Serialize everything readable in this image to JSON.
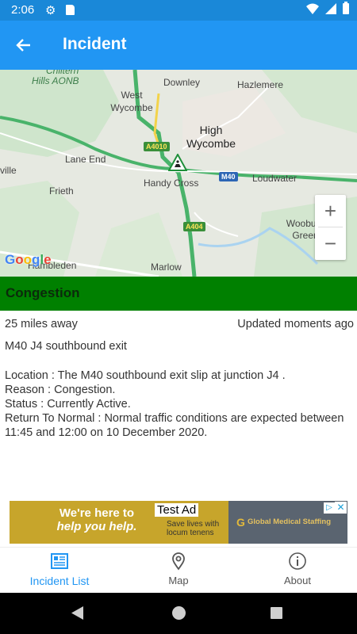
{
  "status_bar": {
    "time": "2:06",
    "icons": [
      "gear-icon",
      "sd-card-icon",
      "wifi-icon",
      "signal-icon",
      "battery-icon"
    ]
  },
  "app_bar": {
    "title": "Incident",
    "back_icon": "arrow-back-icon",
    "color": "#2196f3"
  },
  "map": {
    "labels": {
      "chiltern": "Chiltern",
      "hills_aonb": "Hills AONB",
      "downley": "Downley",
      "hazlemere": "Hazlemere",
      "west_wycombe": "West Wycombe",
      "high_wycombe": "High Wycombe",
      "lane_end": "Lane End",
      "ville": "ville",
      "frieth": "Frieth",
      "handy_cross": "Handy Cross",
      "loudwater": "Loudwater",
      "wooburn_green": "Wooburn Green",
      "hambleden": "Hambleden",
      "marlow": "Marlow"
    },
    "road_shields": {
      "a4010": "A4010",
      "m40": "M40",
      "a404": "A404"
    },
    "zoom_in": "+",
    "zoom_out": "−",
    "attribution": "Google"
  },
  "incident": {
    "status": "Congestion",
    "status_color": "#008000",
    "distance": "25 miles away",
    "updated": "Updated moments ago",
    "title": "M40 J4 southbound exit",
    "location": "Location : The M40 southbound exit slip at junction J4 .",
    "reason": "Reason : Congestion.",
    "status_line": "Status : Currently Active.",
    "return_to_normal": "Return To Normal : Normal traffic conditions are expected between 11:45 and 12:00 on 10 December 2020."
  },
  "ad": {
    "headline_1": "We're here to",
    "headline_2": "help you help.",
    "test_label": "Test Ad",
    "sub_1": "Save lives with",
    "sub_2": "locum tenens",
    "brand": "Global Medical Staffing",
    "choices_icon": "ad-choices-icon",
    "close": "✕"
  },
  "bottom_nav": {
    "items": [
      {
        "label": "Incident List",
        "icon": "list-icon",
        "active": true
      },
      {
        "label": "Map",
        "icon": "map-pin-icon",
        "active": false
      },
      {
        "label": "About",
        "icon": "info-icon",
        "active": false
      }
    ]
  }
}
